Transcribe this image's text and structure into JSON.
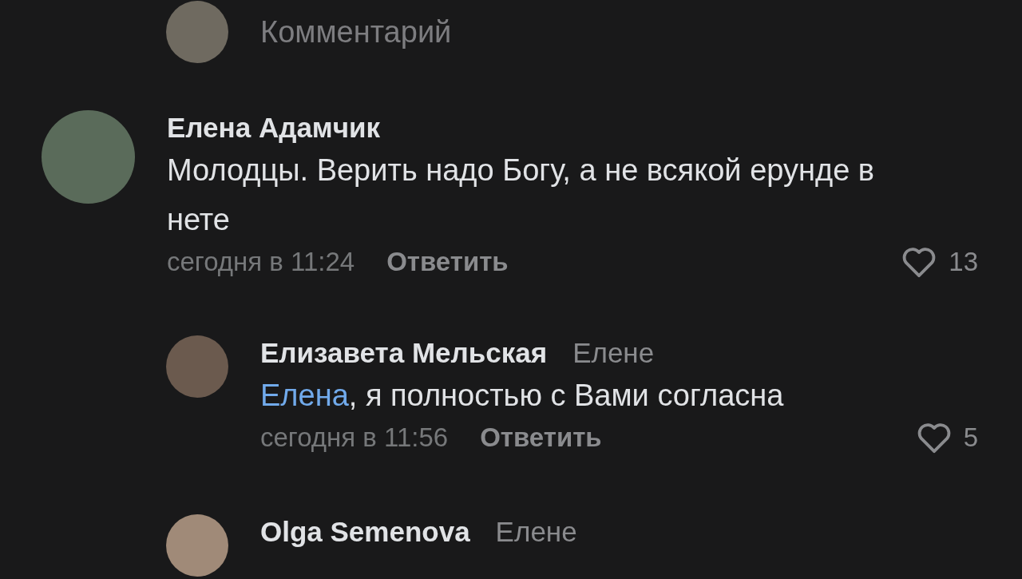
{
  "composer": {
    "placeholder": "Комментарий"
  },
  "comments": [
    {
      "author": "Елена Адамчик",
      "text": "Молодцы. Верить надо Богу, а не всякой ерунде в нете",
      "time": "сегодня в 11:24",
      "reply": "Ответить",
      "liked": false,
      "likes": "13",
      "replies": [
        {
          "author": "Елизавета Мельская",
          "to": "Елене",
          "mention": "Елена",
          "text": ", я полностью с Вами согласна",
          "time": "сегодня в 11:56",
          "reply": "Ответить",
          "liked": false,
          "likes": "5"
        },
        {
          "author": "Olga Semenova",
          "to": "Елене"
        }
      ]
    }
  ]
}
